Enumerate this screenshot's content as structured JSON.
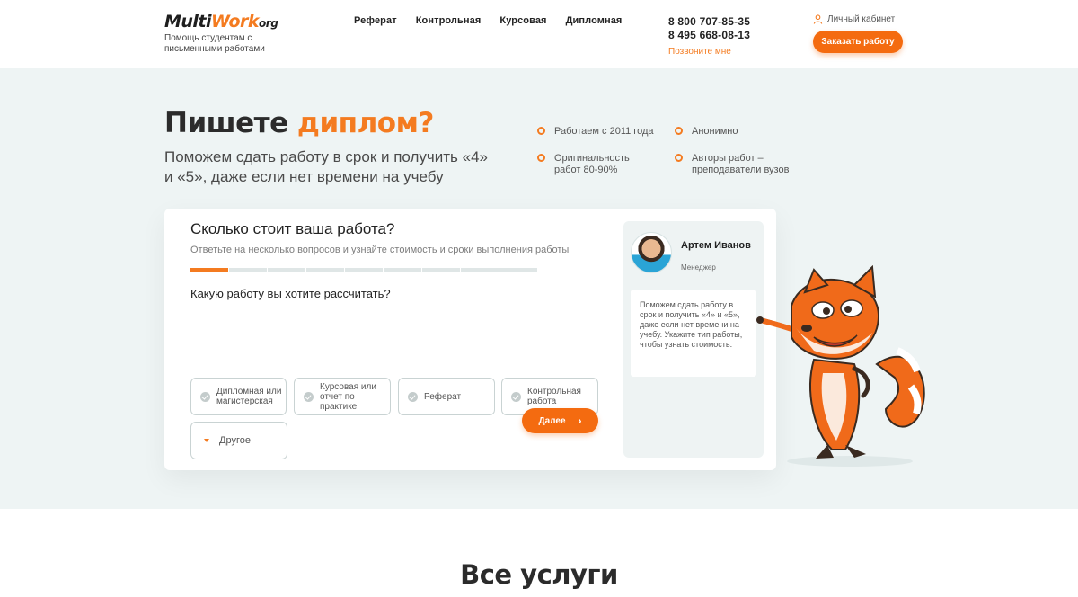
{
  "header": {
    "logo": {
      "part1": "Multi",
      "part2": "Work",
      "part3": "org"
    },
    "tagline": "Помощь студентам с письменными работами",
    "nav": [
      "Реферат",
      "Контрольная",
      "Курсовая",
      "Дипломная"
    ],
    "phones": [
      "8 800 707-85-35",
      "8 495 668-08-13"
    ],
    "callme": "Позвоните мне",
    "cabinet": "Личный кабинет",
    "order_button": "Заказать работу"
  },
  "hero": {
    "title_part1": "Пишете ",
    "title_accent": "диплом?",
    "subtitle": "Поможем сдать работу в срок и получить «4» и «5», даже если нет времени на учебу",
    "features": [
      "Работаем с 2011 года",
      "Анонимно",
      "Оригинальность работ 80-90%",
      "Авторы работ – преподаватели вузов"
    ]
  },
  "calculator": {
    "title": "Сколько стоит ваша работа?",
    "description": "Ответьте на несколько вопросов и узнайте стоимость и сроки выполнения работы",
    "progress": {
      "step": 1,
      "total": 9
    },
    "question": "Какую работу вы хотите рассчитать?",
    "options": [
      "Дипломная или магистерская",
      "Курсовая или отчет по практике",
      "Реферат",
      "Контрольная работа",
      "Другое"
    ],
    "next_button": "Далее"
  },
  "manager": {
    "name": "Артем Иванов",
    "role": "Менеджер",
    "message": "Поможем сдать работу в срок и получить «4» и «5», даже если нет времени на учебу. Укажите тип работы, чтобы узнать стоимость."
  },
  "services_heading": "Все услуги",
  "colors": {
    "accent": "#f47b20",
    "hero_bg": "#eef4f4",
    "button": "#f46b10"
  }
}
